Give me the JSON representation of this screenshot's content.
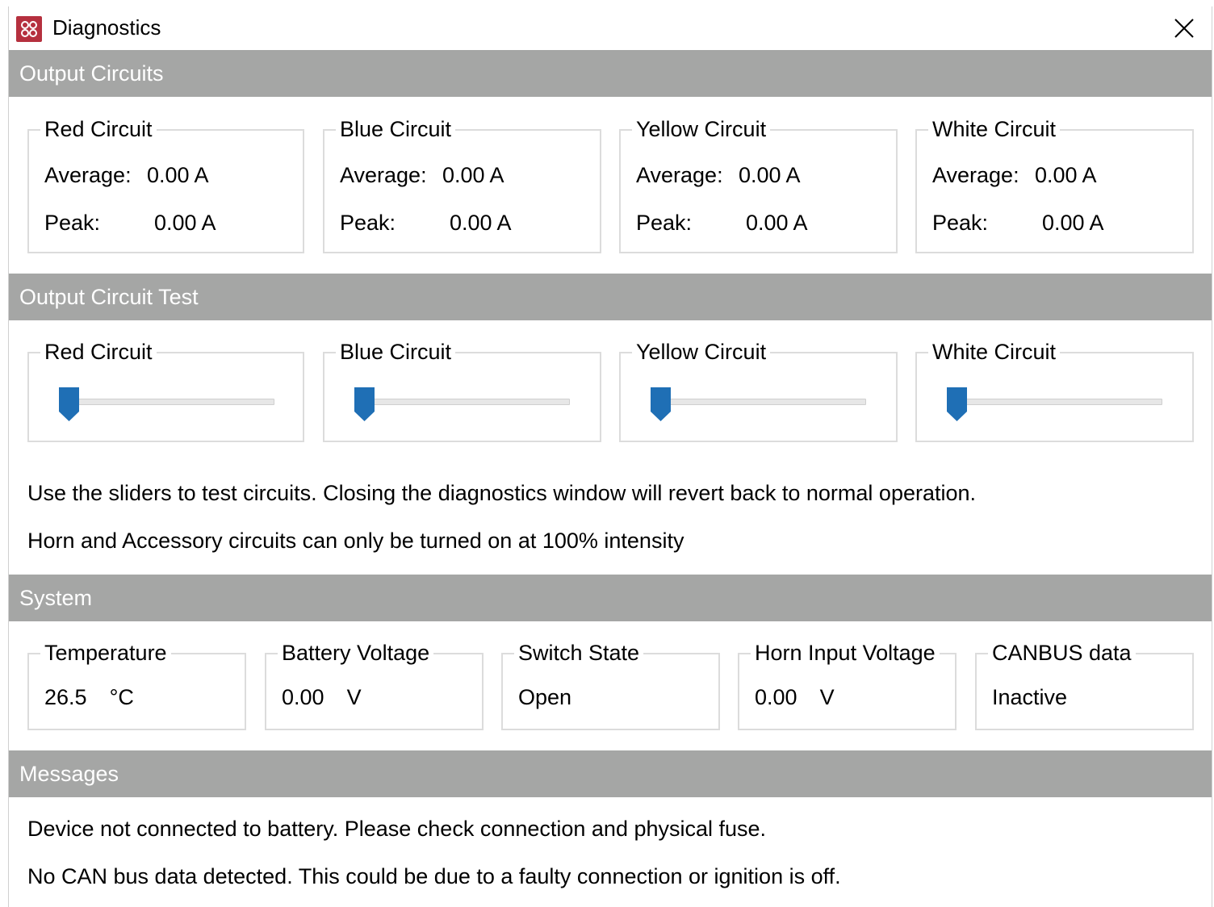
{
  "window": {
    "title": "Diagnostics"
  },
  "output_circuits": {
    "header": "Output Circuits",
    "average_label": "Average:",
    "peak_label": "Peak:",
    "circuits": [
      {
        "name": "Red Circuit",
        "average": "0.00 A",
        "peak": "0.00 A"
      },
      {
        "name": "Blue Circuit",
        "average": "0.00 A",
        "peak": "0.00 A"
      },
      {
        "name": "Yellow Circuit",
        "average": "0.00 A",
        "peak": "0.00 A"
      },
      {
        "name": "White Circuit",
        "average": "0.00 A",
        "peak": "0.00 A"
      }
    ]
  },
  "output_circuit_test": {
    "header": "Output Circuit Test",
    "sliders": [
      {
        "name": "Red Circuit",
        "level_fraction": 0
      },
      {
        "name": "Blue Circuit",
        "level_fraction": 0
      },
      {
        "name": "Yellow Circuit",
        "level_fraction": 0
      },
      {
        "name": "White Circuit",
        "level_fraction": 0
      }
    ],
    "info_line_1": "Use the sliders to test circuits. Closing the diagnostics window will revert back to normal operation.",
    "info_line_2": "Horn and Accessory circuits can only be turned on at 100% intensity"
  },
  "system": {
    "header": "System",
    "temperature": {
      "label": "Temperature",
      "value": "26.5",
      "unit": "°C"
    },
    "battery_voltage": {
      "label": "Battery Voltage",
      "value": "0.00",
      "unit": "V"
    },
    "switch_state": {
      "label": "Switch State",
      "value": "Open"
    },
    "horn_input_voltage": {
      "label": "Horn Input Voltage",
      "value": "0.00",
      "unit": "V"
    },
    "canbus": {
      "label": "CANBUS data",
      "value": "Inactive"
    }
  },
  "messages": {
    "header": "Messages",
    "lines": [
      "Device not connected to battery. Please check connection and physical fuse.",
      "No CAN bus data detected. This could be due to a faulty connection or ignition is off."
    ]
  },
  "colors": {
    "section_header_bg": "#a5a6a5",
    "slider_thumb": "#1f6fb5",
    "app_icon": "#b5303e"
  },
  "icons": {
    "app": "app-logo-icon",
    "close": "close-icon"
  }
}
